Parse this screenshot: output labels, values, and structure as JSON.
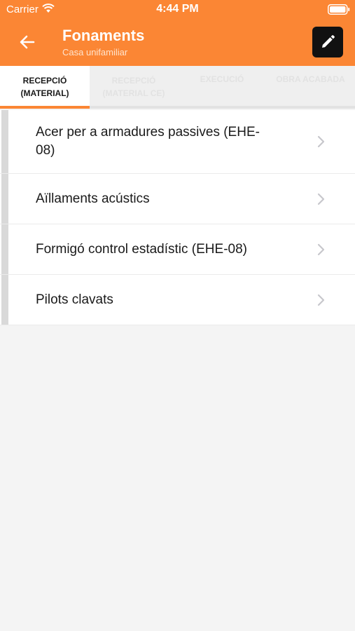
{
  "status_bar": {
    "carrier": "Carrier",
    "time": "4:44 PM"
  },
  "header": {
    "title": "Fonaments",
    "subtitle": "Casa unifamiliar",
    "back_icon": "arrow-left-icon",
    "edit_icon": "pencil-icon"
  },
  "tabs": [
    {
      "line1": "RECEPCIÓ",
      "line2": "(MATERIAL)",
      "active": true
    },
    {
      "line1": "RECEPCIÓ",
      "line2": "(MATERIAL CE)",
      "active": false
    },
    {
      "line1": "EXECUCIÓ",
      "line2": "",
      "active": false
    },
    {
      "line1": "OBRA ACABADA",
      "line2": "",
      "active": false
    }
  ],
  "items": [
    {
      "label": "Acer per a armadures passives (EHE-08)"
    },
    {
      "label": "Aïllaments acústics"
    },
    {
      "label": "Formigó control estadístic (EHE-08)"
    },
    {
      "label": "Pilots clavats"
    }
  ],
  "colors": {
    "accent": "#fb8634",
    "edit_button": "#111111"
  }
}
